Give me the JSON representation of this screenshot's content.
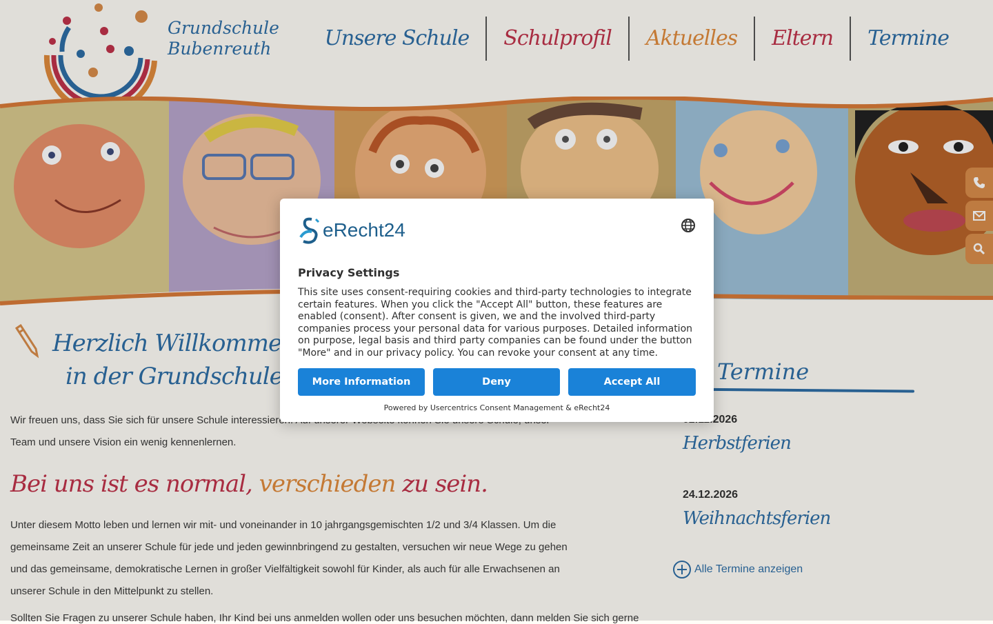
{
  "header": {
    "school_name_line1": "Grundschule",
    "school_name_line2": "Bubenreuth",
    "nav": [
      {
        "label": "Unsere Schule",
        "color": "#2e6ea6"
      },
      {
        "label": "Schulprofil",
        "color": "#c0334a"
      },
      {
        "label": "Aktuelles",
        "color": "#e08a3c"
      },
      {
        "label": "Eltern",
        "color": "#c0334a"
      },
      {
        "label": "Termine",
        "color": "#2e6ea6"
      }
    ]
  },
  "side_buttons": [
    {
      "icon": "phone-icon"
    },
    {
      "icon": "mail-icon"
    },
    {
      "icon": "search-icon"
    }
  ],
  "main": {
    "welcome_line1": "Herzlich Willkommen",
    "welcome_line2": "in der Grundschule Bubenreuth",
    "intro": "Wir freuen uns, dass Sie sich für unsere Schule interessieren. Auf unserer Webseite können Sie unsere Schule, unser Team und unsere Vision ein wenig kennenlernen.",
    "motto_part1": "Bei uns ist es normal, ",
    "motto_part2": "verschieden",
    "motto_part3": " zu sein.",
    "body": "Unter diesem Motto leben und lernen wir mit- und voneinander in 10 jahrgangsgemischten 1/2 und 3/4 Klassen. Um die gemeinsame Zeit an unserer Schule für jede und jeden gewinnbringend zu gestalten, versuchen wir neue Wege zu gehen und das gemeinsame, demokratische Lernen in großer Vielfältigkeit sowohl für Kinder, als auch für alle Erwachsenen an unserer Schule in den Mittelpunkt zu stellen.",
    "body_cut": "Sollten Sie Fragen zu unserer Schule haben, Ihr Kind bei uns anmelden wollen oder uns besuchen möchten, dann melden Sie sich gerne"
  },
  "termine": {
    "title": "Termine",
    "items": [
      {
        "date": "02.11.2026",
        "title": "Herbstferien"
      },
      {
        "date": "24.12.2026",
        "title": "Weihnachtsferien"
      }
    ],
    "all_label": "Alle Termine anzeigen"
  },
  "consent": {
    "brand": "eRecht24",
    "title": "Privacy Settings",
    "body": "This site uses consent-requiring cookies and third-party technologies to integrate certain features. When you click the \"Accept All\" button, these features are enabled (consent). After consent is given, we and the involved third-party companies process your personal data for various purposes. Detailed information on purpose, legal basis and third party companies can be found under the button \"More\" and in our privacy policy. You can revoke your consent at any time.",
    "btn_more": "More Information",
    "btn_deny": "Deny",
    "btn_accept": "Accept All",
    "powered": "Powered by Usercentrics Consent Management & eRecht24",
    "button_color": "#1a82d8"
  },
  "colors": {
    "blue": "#2e6ea6",
    "red": "#c0334a",
    "orange": "#e08a3c"
  }
}
